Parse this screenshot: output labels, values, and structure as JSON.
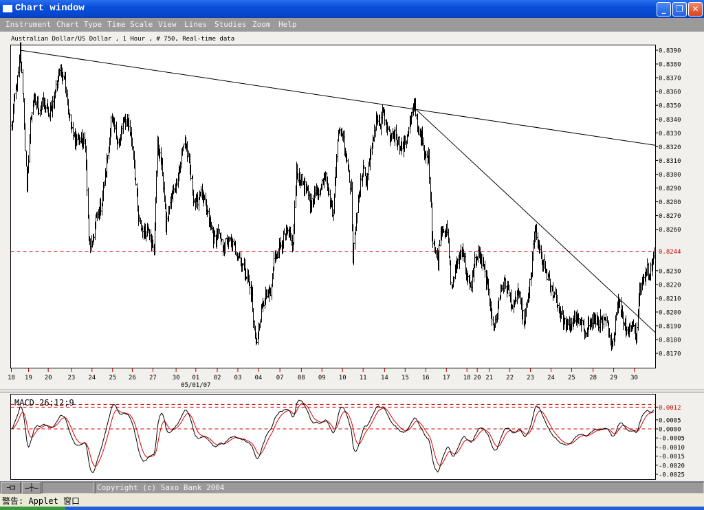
{
  "window": {
    "title": "Chart window",
    "minimize": "_",
    "restore": "❐",
    "close": "✕"
  },
  "menu": [
    "Instrument",
    "Chart Type",
    "Time Scale",
    "View",
    "Lines",
    "Studies",
    "Zoom",
    "Help"
  ],
  "chart_header": "Australian Dollar/US Dollar , 1 Hour , # 750, Real-time data",
  "toolbar": {
    "pin_icon_label": "⊣⊐",
    "crosshair_label": "—┼—",
    "copyright": "Copyright (c) Saxo Bank 2004"
  },
  "status": "警告: Applet 窗口",
  "colors": {
    "accent": "#cc0000",
    "price": "#000000",
    "signal": "#dd0000"
  },
  "chart_data": [
    {
      "type": "ohlc",
      "title": "Australian Dollar/US Dollar , 1 Hour",
      "bars": 750,
      "ylim": [
        0.8162,
        0.8394
      ],
      "y_ticks": [
        "0.8390",
        "0.8380",
        "0.8370",
        "0.8360",
        "0.8350",
        "0.8340",
        "0.8330",
        "0.8320",
        "0.8310",
        "0.8300",
        "0.8290",
        "0.8280",
        "0.8270",
        "0.8260",
        "0.8230",
        "0.8220",
        "0.8210",
        "0.8200",
        "0.8190",
        "0.8180",
        "0.8170"
      ],
      "y_tick_values": [
        0.839,
        0.838,
        0.837,
        0.836,
        0.835,
        0.834,
        0.833,
        0.832,
        0.831,
        0.83,
        0.829,
        0.828,
        0.827,
        0.826,
        0.823,
        0.822,
        0.821,
        0.82,
        0.819,
        0.818,
        0.817
      ],
      "highlight_level": {
        "label": "0.8244",
        "value": 0.8244
      },
      "x_ticks": [
        {
          "label": "18",
          "bar": 0
        },
        {
          "label": "19",
          "bar": 20
        },
        {
          "label": "20",
          "bar": 43
        },
        {
          "label": "23",
          "bar": 70
        },
        {
          "label": "24",
          "bar": 94
        },
        {
          "label": "25",
          "bar": 118
        },
        {
          "label": "26",
          "bar": 141
        },
        {
          "label": "27",
          "bar": 165
        },
        {
          "label": "30",
          "bar": 192
        },
        {
          "label": "01",
          "bar": 215
        },
        {
          "label": "02",
          "bar": 240
        },
        {
          "label": "03",
          "bar": 264
        },
        {
          "label": "04",
          "bar": 288
        },
        {
          "label": "07",
          "bar": 313
        },
        {
          "label": "08",
          "bar": 338
        },
        {
          "label": "09",
          "bar": 362
        },
        {
          "label": "10",
          "bar": 386
        },
        {
          "label": "11",
          "bar": 410
        },
        {
          "label": "14",
          "bar": 435
        },
        {
          "label": "15",
          "bar": 459
        },
        {
          "label": "16",
          "bar": 483
        },
        {
          "label": "17",
          "bar": 507
        },
        {
          "label": "18",
          "bar": 531
        },
        {
          "label": "20",
          "bar": 543
        },
        {
          "label": "21",
          "bar": 557
        },
        {
          "label": "22",
          "bar": 581
        },
        {
          "label": "23",
          "bar": 605
        },
        {
          "label": "24",
          "bar": 629
        },
        {
          "label": "25",
          "bar": 653
        },
        {
          "label": "28",
          "bar": 678
        },
        {
          "label": "29",
          "bar": 702
        },
        {
          "label": "30",
          "bar": 726
        }
      ],
      "x_sublabel": {
        "label": "05/01/07",
        "bar": 215
      },
      "close_path": [
        [
          0,
          0.8334
        ],
        [
          4,
          0.8357
        ],
        [
          8,
          0.8372
        ],
        [
          10,
          0.839
        ],
        [
          14,
          0.8352
        ],
        [
          18,
          0.8287
        ],
        [
          22,
          0.8339
        ],
        [
          26,
          0.8354
        ],
        [
          32,
          0.8347
        ],
        [
          38,
          0.8352
        ],
        [
          44,
          0.8342
        ],
        [
          50,
          0.8357
        ],
        [
          56,
          0.8376
        ],
        [
          62,
          0.8372
        ],
        [
          66,
          0.8347
        ],
        [
          72,
          0.8327
        ],
        [
          80,
          0.8324
        ],
        [
          86,
          0.8322
        ],
        [
          90,
          0.8252
        ],
        [
          94,
          0.8247
        ],
        [
          98,
          0.8267
        ],
        [
          104,
          0.8277
        ],
        [
          110,
          0.8302
        ],
        [
          116,
          0.8339
        ],
        [
          120,
          0.8332
        ],
        [
          126,
          0.8322
        ],
        [
          130,
          0.8337
        ],
        [
          136,
          0.8339
        ],
        [
          142,
          0.8317
        ],
        [
          148,
          0.8267
        ],
        [
          154,
          0.8257
        ],
        [
          160,
          0.8262
        ],
        [
          166,
          0.8242
        ],
        [
          170,
          0.8322
        ],
        [
          176,
          0.8302
        ],
        [
          180,
          0.8262
        ],
        [
          184,
          0.8277
        ],
        [
          192,
          0.8294
        ],
        [
          198,
          0.8312
        ],
        [
          202,
          0.8327
        ],
        [
          208,
          0.8302
        ],
        [
          214,
          0.8277
        ],
        [
          220,
          0.8287
        ],
        [
          228,
          0.8272
        ],
        [
          232,
          0.8262
        ],
        [
          236,
          0.8252
        ],
        [
          241,
          0.8257
        ],
        [
          246,
          0.8247
        ],
        [
          252,
          0.8252
        ],
        [
          260,
          0.8247
        ],
        [
          268,
          0.8237
        ],
        [
          274,
          0.8227
        ],
        [
          280,
          0.8212
        ],
        [
          282,
          0.8192
        ],
        [
          286,
          0.8177
        ],
        [
          290,
          0.8197
        ],
        [
          296,
          0.8212
        ],
        [
          302,
          0.8212
        ],
        [
          306,
          0.8237
        ],
        [
          312,
          0.8247
        ],
        [
          316,
          0.8252
        ],
        [
          322,
          0.8257
        ],
        [
          328,
          0.8247
        ],
        [
          332,
          0.8302
        ],
        [
          336,
          0.8297
        ],
        [
          340,
          0.8294
        ],
        [
          344,
          0.8287
        ],
        [
          348,
          0.8277
        ],
        [
          354,
          0.8287
        ],
        [
          360,
          0.8289
        ],
        [
          366,
          0.8304
        ],
        [
          370,
          0.8282
        ],
        [
          375,
          0.8272
        ],
        [
          380,
          0.8327
        ],
        [
          384,
          0.8332
        ],
        [
          388,
          0.8322
        ],
        [
          392,
          0.8307
        ],
        [
          396,
          0.8289
        ],
        [
          398,
          0.8237
        ],
        [
          402,
          0.8272
        ],
        [
          404,
          0.8277
        ],
        [
          410,
          0.8307
        ],
        [
          414,
          0.8292
        ],
        [
          417,
          0.8312
        ],
        [
          420,
          0.8317
        ],
        [
          425,
          0.8342
        ],
        [
          430,
          0.8334
        ],
        [
          433,
          0.8347
        ],
        [
          438,
          0.8329
        ],
        [
          442,
          0.8327
        ],
        [
          447,
          0.8329
        ],
        [
          452,
          0.8322
        ],
        [
          457,
          0.8319
        ],
        [
          462,
          0.8332
        ],
        [
          466,
          0.8342
        ],
        [
          470,
          0.8348
        ],
        [
          474,
          0.8332
        ],
        [
          478,
          0.8327
        ],
        [
          481,
          0.8312
        ],
        [
          486,
          0.8312
        ],
        [
          489,
          0.8277
        ],
        [
          490,
          0.8257
        ],
        [
          494,
          0.8242
        ],
        [
          497,
          0.8239
        ],
        [
          500,
          0.8259
        ],
        [
          504,
          0.8262
        ],
        [
          508,
          0.8257
        ],
        [
          513,
          0.8217
        ],
        [
          516,
          0.8227
        ],
        [
          520,
          0.8237
        ],
        [
          526,
          0.8247
        ],
        [
          530,
          0.8227
        ],
        [
          535,
          0.8217
        ],
        [
          540,
          0.8237
        ],
        [
          545,
          0.8242
        ],
        [
          550,
          0.8232
        ],
        [
          554,
          0.8222
        ],
        [
          559,
          0.8202
        ],
        [
          562,
          0.8187
        ],
        [
          566,
          0.8199
        ],
        [
          570,
          0.8217
        ],
        [
          575,
          0.8222
        ],
        [
          580,
          0.8212
        ],
        [
          585,
          0.8202
        ],
        [
          590,
          0.8217
        ],
        [
          594,
          0.8202
        ],
        [
          598,
          0.8192
        ],
        [
          602,
          0.8212
        ],
        [
          606,
          0.8227
        ],
        [
          608,
          0.8252
        ],
        [
          610,
          0.8259
        ],
        [
          614,
          0.8247
        ],
        [
          618,
          0.8237
        ],
        [
          624,
          0.8227
        ],
        [
          628,
          0.8217
        ],
        [
          634,
          0.8212
        ],
        [
          638,
          0.8202
        ],
        [
          642,
          0.8197
        ],
        [
          648,
          0.8187
        ],
        [
          652,
          0.8192
        ],
        [
          657,
          0.8197
        ],
        [
          662,
          0.8192
        ],
        [
          668,
          0.8187
        ],
        [
          673,
          0.8192
        ],
        [
          678,
          0.8194
        ],
        [
          682,
          0.8194
        ],
        [
          689,
          0.8192
        ],
        [
          694,
          0.8192
        ],
        [
          698,
          0.8177
        ],
        [
          702,
          0.8182
        ],
        [
          706,
          0.8207
        ],
        [
          710,
          0.8204
        ],
        [
          714,
          0.8192
        ],
        [
          720,
          0.8187
        ],
        [
          724,
          0.8192
        ],
        [
          728,
          0.8182
        ],
        [
          732,
          0.8217
        ],
        [
          736,
          0.8222
        ],
        [
          740,
          0.8232
        ],
        [
          744,
          0.8227
        ],
        [
          748,
          0.8242
        ],
        [
          750,
          0.8247
        ]
      ],
      "trend_lines": [
        {
          "from": [
            10,
            0.839
          ],
          "to": [
            750,
            0.8321
          ]
        },
        {
          "from": [
            470,
            0.8348
          ],
          "to": [
            750,
            0.8185
          ]
        }
      ]
    },
    {
      "type": "line",
      "title": "MACD 26;12;9",
      "params": {
        "slow": 26,
        "fast": 12,
        "signal": 9
      },
      "series": [
        {
          "name": "MACD",
          "color": "#000000"
        },
        {
          "name": "Signal",
          "color": "#dd0000"
        }
      ],
      "ylim": [
        -0.0027,
        0.0018
      ],
      "y_ticks": [
        "0.0005",
        "0.0000",
        "-0.0005",
        "-0.0010",
        "-0.0015",
        "-0.0020",
        "-0.0025"
      ],
      "y_tick_values": [
        0.0005,
        0,
        -0.0005,
        -0.001,
        -0.0015,
        -0.002,
        -0.0025
      ],
      "highlight_level": {
        "label": "0.0012",
        "value": 0.0012
      },
      "reference_lines": [
        0.00135,
        0.0012,
        0.0
      ]
    }
  ]
}
